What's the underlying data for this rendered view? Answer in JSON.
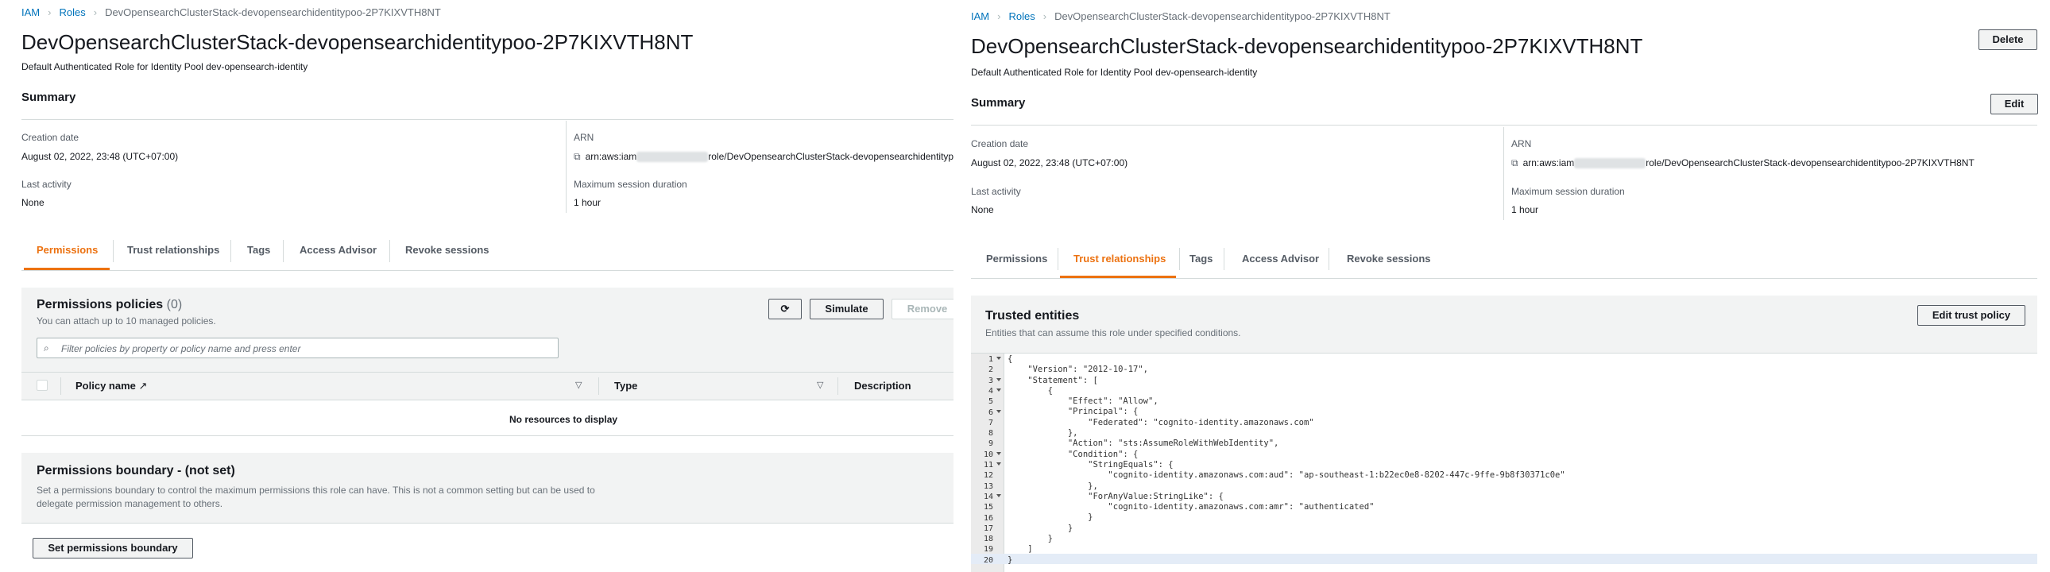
{
  "breadcrumb": {
    "iam": "IAM",
    "roles": "Roles",
    "current": "DevOpensearchClusterStack-devopensearchidentitypoo-2P7KIXVTH8NT"
  },
  "role": {
    "name": "DevOpensearchClusterStack-devopensearchidentitypoo-2P7KIXVTH8NT",
    "description": "Default Authenticated Role for Identity Pool dev-opensearch-identity"
  },
  "buttons": {
    "delete": "Delete",
    "edit": "Edit",
    "simulate": "Simulate",
    "remove": "Remove",
    "edit_trust_policy": "Edit trust policy",
    "set_boundary": "Set permissions boundary"
  },
  "summary": {
    "heading": "Summary",
    "creation_label": "Creation date",
    "creation_value": "August 02, 2022, 23:48 (UTC+07:00)",
    "activity_label": "Last activity",
    "activity_value": "None",
    "arn_label": "ARN",
    "arn_prefix": "arn:aws:iam",
    "arn_suffix": "role/DevOpensearchClusterStack-devopensearchidentitypoo-2P7KIXVTH8NT",
    "session_label": "Maximum session duration",
    "session_value": "1 hour"
  },
  "tabs": [
    "Permissions",
    "Trust relationships",
    "Tags",
    "Access Advisor",
    "Revoke sessions"
  ],
  "permissions": {
    "heading": "Permissions policies",
    "count": "(0)",
    "subtitle": "You can attach up to 10 managed policies.",
    "filter_placeholder": "Filter policies by property or policy name and press enter",
    "columns": [
      "Policy name",
      "Type",
      "Description"
    ],
    "empty": "No resources to display"
  },
  "boundary": {
    "heading": "Permissions boundary - (not set)",
    "text1": "Set a permissions boundary to control the maximum permissions this role can have. This is not a common setting but can be used to",
    "text2": "delegate permission management to others."
  },
  "trusted": {
    "heading": "Trusted entities",
    "subtitle": "Entities that can assume this role under specified conditions."
  },
  "policy_lines": [
    "{",
    "    \"Version\": \"2012-10-17\",",
    "    \"Statement\": [",
    "        {",
    "            \"Effect\": \"Allow\",",
    "            \"Principal\": {",
    "                \"Federated\": \"cognito-identity.amazonaws.com\"",
    "            },",
    "            \"Action\": \"sts:AssumeRoleWithWebIdentity\",",
    "            \"Condition\": {",
    "                \"StringEquals\": {",
    "                    \"cognito-identity.amazonaws.com:aud\": \"ap-southeast-1:b22ec0e8-8202-447c-9ffe-9b8f30371c0e\"",
    "                },",
    "                \"ForAnyValue:StringLike\": {",
    "                    \"cognito-identity.amazonaws.com:amr\": \"authenticated\"",
    "                }",
    "            }",
    "        }",
    "    ]",
    "}"
  ],
  "line_numbers": [
    "1",
    "2",
    "3",
    "4",
    "5",
    "6",
    "7",
    "8",
    "9",
    "10",
    "11",
    "12",
    "13",
    "14",
    "15",
    "16",
    "17",
    "18",
    "19",
    "20"
  ],
  "icons": {
    "breadcrumb_sep": "chevron-right-icon",
    "copy": "copy-icon",
    "refresh": "refresh-icon",
    "search": "search-icon",
    "external": "external-link-icon",
    "sort": "sort-down-icon"
  },
  "colors": {
    "accent": "#ec7211",
    "link": "#0073bb"
  }
}
